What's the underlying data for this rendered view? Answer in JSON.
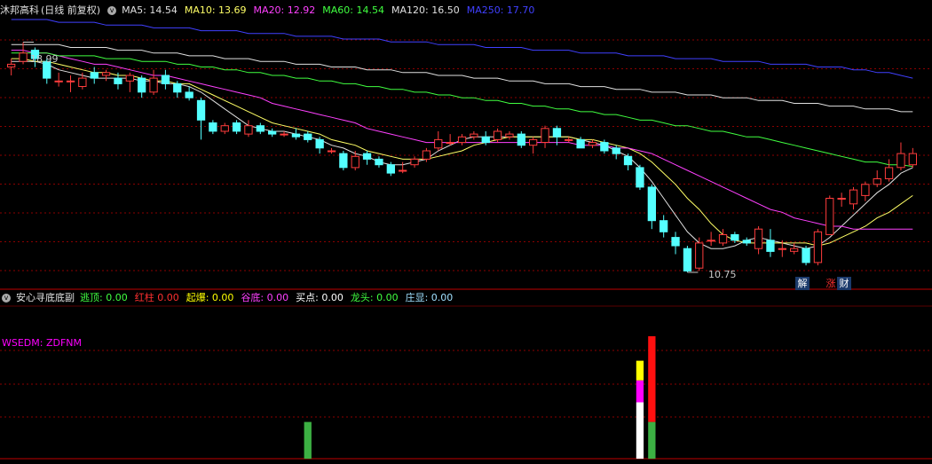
{
  "header": {
    "stock_name": "沐邦高科",
    "period_label": "(日线 前复权)",
    "ma": [
      {
        "label": "MA5:",
        "value": "14.54",
        "color": "#e0e0e0"
      },
      {
        "label": "MA10:",
        "value": "13.69",
        "color": "#ffff66"
      },
      {
        "label": "MA20:",
        "value": "12.92",
        "color": "#ff40ff"
      },
      {
        "label": "MA60:",
        "value": "14.54",
        "color": "#40ff40"
      },
      {
        "label": "MA120:",
        "value": "16.50",
        "color": "#e0e0e0"
      },
      {
        "label": "MA250:",
        "value": "17.70",
        "color": "#4040ff"
      }
    ]
  },
  "sub_header": {
    "indicator_name": "安心寻底底副",
    "items": [
      {
        "label": "逃顶:",
        "value": "0.00",
        "color": "#40ff40"
      },
      {
        "label": "红柱",
        "value": "0.00",
        "color": "#ff3030"
      },
      {
        "label": "起爆:",
        "value": "0.00",
        "color": "#ffff00"
      },
      {
        "label": "谷底:",
        "value": "0.00",
        "color": "#ff40ff"
      },
      {
        "label": "买点:",
        "value": "0.00",
        "color": "#ffffff"
      },
      {
        "label": "龙头:",
        "value": "0.00",
        "color": "#40ff40"
      },
      {
        "label": "庄显:",
        "value": "0.00",
        "color": "#a0e0ff"
      }
    ]
  },
  "subpanel_label": "WSEDM: ZDFNM",
  "annotations": {
    "high": "18.99",
    "low": "10.75"
  },
  "signals": {
    "jie": "解",
    "zhang": "涨",
    "cai": "财"
  },
  "chart_data": {
    "type": "candlestick",
    "ylim": [
      10.4,
      19.8
    ],
    "colors": {
      "up": "#ff3c3c",
      "down": "#54ffff",
      "grid": "#8b0000"
    },
    "candles": [
      [
        18.1,
        18.2,
        18.4,
        17.8
      ],
      [
        18.3,
        18.6,
        18.99,
        18.2
      ],
      [
        18.7,
        18.4,
        18.8,
        18.1
      ],
      [
        18.3,
        17.7,
        18.4,
        17.5
      ],
      [
        17.6,
        17.6,
        17.9,
        17.4
      ],
      [
        17.6,
        17.6,
        17.8,
        17.2
      ],
      [
        17.4,
        17.7,
        17.9,
        17.3
      ],
      [
        17.9,
        17.7,
        18.1,
        17.5
      ],
      [
        17.8,
        17.9,
        18.0,
        17.6
      ],
      [
        17.7,
        17.5,
        17.9,
        17.3
      ],
      [
        17.6,
        17.8,
        17.9,
        17.2
      ],
      [
        17.7,
        17.2,
        17.8,
        17.0
      ],
      [
        17.2,
        17.7,
        18.0,
        17.1
      ],
      [
        17.8,
        17.5,
        18.0,
        17.3
      ],
      [
        17.5,
        17.2,
        17.6,
        17.0
      ],
      [
        17.2,
        17.0,
        17.4,
        16.9
      ],
      [
        16.9,
        16.2,
        17.0,
        15.5
      ],
      [
        16.1,
        15.8,
        16.2,
        15.7
      ],
      [
        15.8,
        16.0,
        16.1,
        15.7
      ],
      [
        16.1,
        15.8,
        16.2,
        15.7
      ],
      [
        15.7,
        16.0,
        16.2,
        15.6
      ],
      [
        16.0,
        15.8,
        16.1,
        15.7
      ],
      [
        15.8,
        15.7,
        15.9,
        15.6
      ],
      [
        15.7,
        15.7,
        15.8,
        15.6
      ],
      [
        15.7,
        15.6,
        15.9,
        15.5
      ],
      [
        15.7,
        15.5,
        15.8,
        15.4
      ],
      [
        15.5,
        15.2,
        15.6,
        15.0
      ],
      [
        15.1,
        15.1,
        15.2,
        15.0
      ],
      [
        15.0,
        14.5,
        15.1,
        14.4
      ],
      [
        14.5,
        14.9,
        15.1,
        14.4
      ],
      [
        15.0,
        14.8,
        15.1,
        14.6
      ],
      [
        14.8,
        14.6,
        14.9,
        14.5
      ],
      [
        14.6,
        14.3,
        14.7,
        14.2
      ],
      [
        14.4,
        14.4,
        14.7,
        14.3
      ],
      [
        14.6,
        14.8,
        14.9,
        14.5
      ],
      [
        14.8,
        15.1,
        15.2,
        14.7
      ],
      [
        15.2,
        15.5,
        15.8,
        15.1
      ],
      [
        15.4,
        15.4,
        15.7,
        15.3
      ],
      [
        15.4,
        15.6,
        15.7,
        15.3
      ],
      [
        15.6,
        15.7,
        15.8,
        15.5
      ],
      [
        15.6,
        15.4,
        15.8,
        15.3
      ],
      [
        15.5,
        15.8,
        15.9,
        15.4
      ],
      [
        15.6,
        15.7,
        15.8,
        15.5
      ],
      [
        15.7,
        15.3,
        15.8,
        15.2
      ],
      [
        15.3,
        15.5,
        15.6,
        15.0
      ],
      [
        15.4,
        15.9,
        16.0,
        15.2
      ],
      [
        15.9,
        15.6,
        16.0,
        15.3
      ],
      [
        15.5,
        15.5,
        15.6,
        15.4
      ],
      [
        15.5,
        15.2,
        15.6,
        15.2
      ],
      [
        15.3,
        15.4,
        15.5,
        15.2
      ],
      [
        15.4,
        15.1,
        15.5,
        15.0
      ],
      [
        15.2,
        15.0,
        15.3,
        14.8
      ],
      [
        14.9,
        14.6,
        15.0,
        14.4
      ],
      [
        14.5,
        13.8,
        14.6,
        13.7
      ],
      [
        13.8,
        12.6,
        13.9,
        12.3
      ],
      [
        12.6,
        12.2,
        12.8,
        12.0
      ],
      [
        12.0,
        11.7,
        12.2,
        11.4
      ],
      [
        11.6,
        10.8,
        11.7,
        10.75
      ],
      [
        10.9,
        11.8,
        12.0,
        10.8
      ],
      [
        11.9,
        11.9,
        12.2,
        11.7
      ],
      [
        11.8,
        12.1,
        12.3,
        11.7
      ],
      [
        12.1,
        11.9,
        12.2,
        11.8
      ],
      [
        11.9,
        11.8,
        12.0,
        11.7
      ],
      [
        11.6,
        12.3,
        12.4,
        11.4
      ],
      [
        11.9,
        11.5,
        12.3,
        11.3
      ],
      [
        11.6,
        11.6,
        11.9,
        11.3
      ],
      [
        11.5,
        11.6,
        11.8,
        11.4
      ],
      [
        11.6,
        11.1,
        11.7,
        11.0
      ],
      [
        11.1,
        12.2,
        12.3,
        11.0
      ],
      [
        12.1,
        13.4,
        13.5,
        12.1
      ],
      [
        13.4,
        13.4,
        13.6,
        13.1
      ],
      [
        13.2,
        13.7,
        13.8,
        13.0
      ],
      [
        13.5,
        13.9,
        14.0,
        13.3
      ],
      [
        13.9,
        14.1,
        14.4,
        13.8
      ],
      [
        14.1,
        14.5,
        14.8,
        14.0
      ],
      [
        14.5,
        15.0,
        15.4,
        14.4
      ],
      [
        14.6,
        15.0,
        15.2,
        14.5
      ]
    ],
    "ma": {
      "MA5": {
        "color": "#e0e0e0",
        "values": [
          18.3,
          18.3,
          18.3,
          18.2,
          18.0,
          17.9,
          17.8,
          17.7,
          17.7,
          17.7,
          17.7,
          17.6,
          17.6,
          17.5,
          17.5,
          17.4,
          17.2,
          16.9,
          16.6,
          16.3,
          16.0,
          15.9,
          15.8,
          15.8,
          15.7,
          15.6,
          15.5,
          15.3,
          15.2,
          15.0,
          14.9,
          14.7,
          14.6,
          14.6,
          14.7,
          14.8,
          15.1,
          15.3,
          15.5,
          15.6,
          15.6,
          15.6,
          15.6,
          15.6,
          15.6,
          15.6,
          15.6,
          15.6,
          15.5,
          15.4,
          15.3,
          15.1,
          14.9,
          14.5,
          14.0,
          13.4,
          12.8,
          12.2,
          11.8,
          11.6,
          11.6,
          11.7,
          11.9,
          12.0,
          11.9,
          11.8,
          11.7,
          11.6,
          11.7,
          12.0,
          12.4,
          12.8,
          13.2,
          13.6,
          13.9,
          14.3,
          14.5
        ]
      },
      "MA10": {
        "color": "#ffff66",
        "values": [
          18.4,
          18.4,
          18.3,
          18.3,
          18.2,
          18.1,
          18.0,
          17.9,
          17.9,
          17.8,
          17.8,
          17.7,
          17.6,
          17.6,
          17.5,
          17.5,
          17.3,
          17.1,
          16.9,
          16.7,
          16.5,
          16.3,
          16.1,
          16.0,
          15.9,
          15.8,
          15.7,
          15.5,
          15.4,
          15.3,
          15.1,
          15.0,
          14.9,
          14.8,
          14.8,
          14.8,
          14.9,
          15.0,
          15.1,
          15.3,
          15.4,
          15.5,
          15.6,
          15.6,
          15.6,
          15.6,
          15.6,
          15.6,
          15.5,
          15.5,
          15.4,
          15.3,
          15.2,
          15.0,
          14.7,
          14.3,
          13.9,
          13.4,
          13.0,
          12.5,
          12.1,
          11.9,
          11.8,
          11.8,
          11.8,
          11.8,
          11.8,
          11.8,
          11.7,
          11.8,
          12.0,
          12.2,
          12.4,
          12.7,
          12.9,
          13.2,
          13.5
        ]
      },
      "MA20": {
        "color": "#ff40ff",
        "values": [
          18.7,
          18.7,
          18.6,
          18.6,
          18.5,
          18.4,
          18.3,
          18.2,
          18.2,
          18.1,
          18.0,
          17.9,
          17.8,
          17.8,
          17.7,
          17.6,
          17.5,
          17.4,
          17.3,
          17.2,
          17.1,
          17.0,
          16.8,
          16.7,
          16.6,
          16.5,
          16.4,
          16.3,
          16.2,
          16.1,
          15.9,
          15.8,
          15.7,
          15.6,
          15.5,
          15.4,
          15.4,
          15.4,
          15.4,
          15.4,
          15.4,
          15.4,
          15.4,
          15.4,
          15.4,
          15.4,
          15.4,
          15.4,
          15.3,
          15.3,
          15.3,
          15.2,
          15.2,
          15.1,
          15.0,
          14.8,
          14.6,
          14.4,
          14.2,
          14.0,
          13.8,
          13.6,
          13.4,
          13.2,
          13.0,
          12.9,
          12.7,
          12.6,
          12.5,
          12.4,
          12.4,
          12.3,
          12.3,
          12.3,
          12.3,
          12.3,
          12.3
        ]
      },
      "MA60": {
        "color": "#40ff40",
        "values": [
          18.6,
          18.6,
          18.6,
          18.6,
          18.5,
          18.5,
          18.5,
          18.5,
          18.4,
          18.4,
          18.4,
          18.3,
          18.3,
          18.3,
          18.2,
          18.2,
          18.1,
          18.1,
          18.0,
          18.0,
          17.9,
          17.9,
          17.8,
          17.8,
          17.7,
          17.7,
          17.6,
          17.6,
          17.5,
          17.5,
          17.4,
          17.4,
          17.3,
          17.3,
          17.2,
          17.2,
          17.1,
          17.1,
          17.0,
          17.0,
          16.9,
          16.9,
          16.8,
          16.8,
          16.7,
          16.7,
          16.6,
          16.6,
          16.5,
          16.5,
          16.4,
          16.4,
          16.3,
          16.2,
          16.2,
          16.1,
          16.0,
          16.0,
          15.9,
          15.8,
          15.8,
          15.7,
          15.6,
          15.6,
          15.5,
          15.4,
          15.3,
          15.2,
          15.1,
          15.0,
          14.9,
          14.8,
          14.7,
          14.7,
          14.6,
          14.6,
          14.54
        ]
      },
      "MA120": {
        "color": "#e0e0e0",
        "values": [
          18.9,
          18.9,
          18.9,
          18.9,
          18.9,
          18.8,
          18.8,
          18.8,
          18.8,
          18.7,
          18.7,
          18.7,
          18.6,
          18.6,
          18.6,
          18.5,
          18.5,
          18.5,
          18.4,
          18.4,
          18.4,
          18.3,
          18.3,
          18.3,
          18.2,
          18.2,
          18.2,
          18.1,
          18.1,
          18.1,
          18.0,
          18.0,
          18.0,
          17.9,
          17.9,
          17.9,
          17.8,
          17.8,
          17.8,
          17.7,
          17.7,
          17.7,
          17.6,
          17.6,
          17.6,
          17.5,
          17.5,
          17.5,
          17.4,
          17.4,
          17.4,
          17.3,
          17.3,
          17.3,
          17.2,
          17.2,
          17.2,
          17.1,
          17.1,
          17.1,
          17.0,
          17.0,
          17.0,
          16.9,
          16.9,
          16.9,
          16.8,
          16.8,
          16.8,
          16.7,
          16.7,
          16.7,
          16.6,
          16.6,
          16.6,
          16.5,
          16.5
        ]
      },
      "MA250": {
        "color": "#4040ff",
        "values": [
          19.8,
          19.8,
          19.8,
          19.8,
          19.7,
          19.7,
          19.7,
          19.7,
          19.6,
          19.6,
          19.6,
          19.6,
          19.5,
          19.5,
          19.5,
          19.5,
          19.4,
          19.4,
          19.4,
          19.4,
          19.3,
          19.3,
          19.3,
          19.3,
          19.2,
          19.2,
          19.2,
          19.2,
          19.1,
          19.1,
          19.1,
          19.1,
          19.0,
          19.0,
          19.0,
          19.0,
          18.9,
          18.9,
          18.9,
          18.9,
          18.8,
          18.8,
          18.8,
          18.8,
          18.7,
          18.7,
          18.7,
          18.7,
          18.6,
          18.6,
          18.6,
          18.6,
          18.5,
          18.5,
          18.5,
          18.5,
          18.4,
          18.4,
          18.4,
          18.4,
          18.3,
          18.3,
          18.3,
          18.3,
          18.2,
          18.2,
          18.2,
          18.2,
          18.1,
          18.1,
          18.1,
          18.0,
          18.0,
          17.9,
          17.9,
          17.8,
          17.7
        ]
      }
    },
    "sub_bars": [
      {
        "index": 25,
        "segments": [
          {
            "value": 0.3,
            "color": "#3cb043"
          }
        ]
      },
      {
        "index": 53,
        "segments": [
          {
            "value": 0.46,
            "color": "#ffffff"
          },
          {
            "value": 0.18,
            "color": "#ff00ff"
          },
          {
            "value": 0.16,
            "color": "#ffff00"
          }
        ]
      },
      {
        "index": 54,
        "segments": [
          {
            "value": 0.3,
            "color": "#3cb043"
          },
          {
            "value": 0.7,
            "color": "#ff1010"
          }
        ]
      }
    ]
  }
}
